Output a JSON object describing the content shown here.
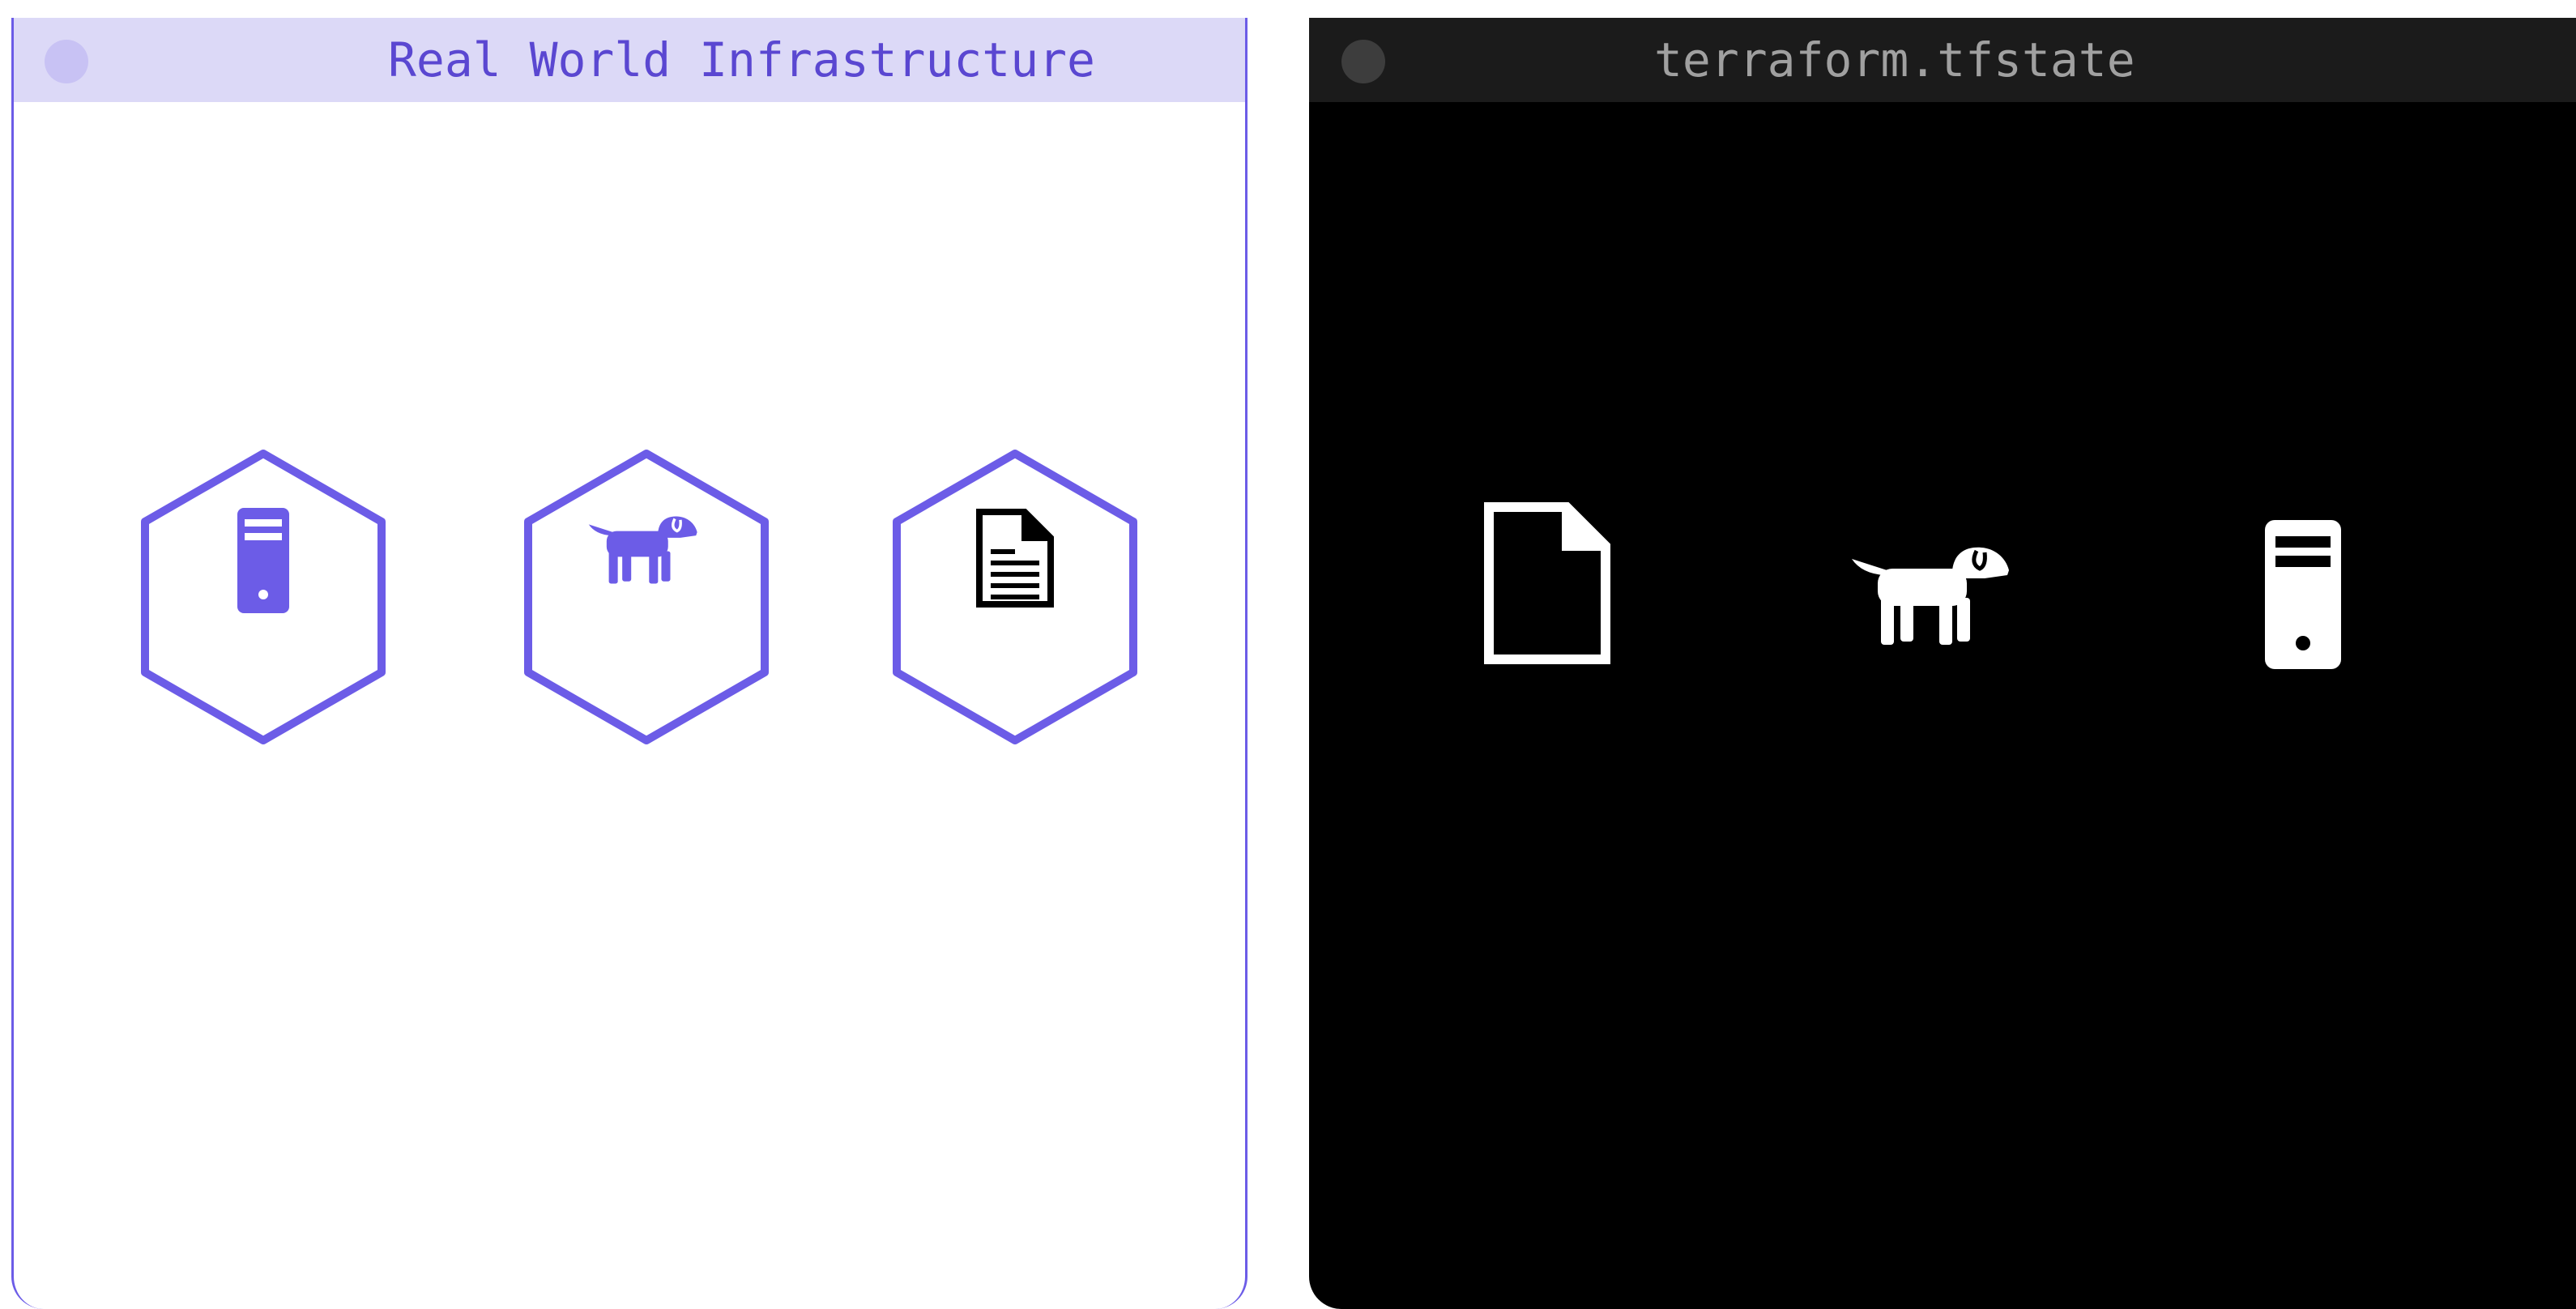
{
  "windows": {
    "left": {
      "title": "Real World Infrastructure",
      "resources": [
        {
          "icon": "server-icon",
          "color": "#6c5ce7"
        },
        {
          "icon": "dog-icon",
          "color": "#6c5ce7"
        },
        {
          "icon": "document-icon",
          "color": "#000000"
        }
      ]
    },
    "right": {
      "title": "terraform.tfstate",
      "resources": [
        {
          "icon": "file-icon",
          "color": "#ffffff"
        },
        {
          "icon": "dog-icon",
          "color": "#ffffff"
        },
        {
          "icon": "server-icon",
          "color": "#ffffff"
        }
      ]
    }
  },
  "colors": {
    "accent": "#6c5ce7",
    "title_light": "#5a47d1",
    "titlebar_light": "#dcd9f7",
    "titlebar_dark": "#1b1b1b"
  }
}
